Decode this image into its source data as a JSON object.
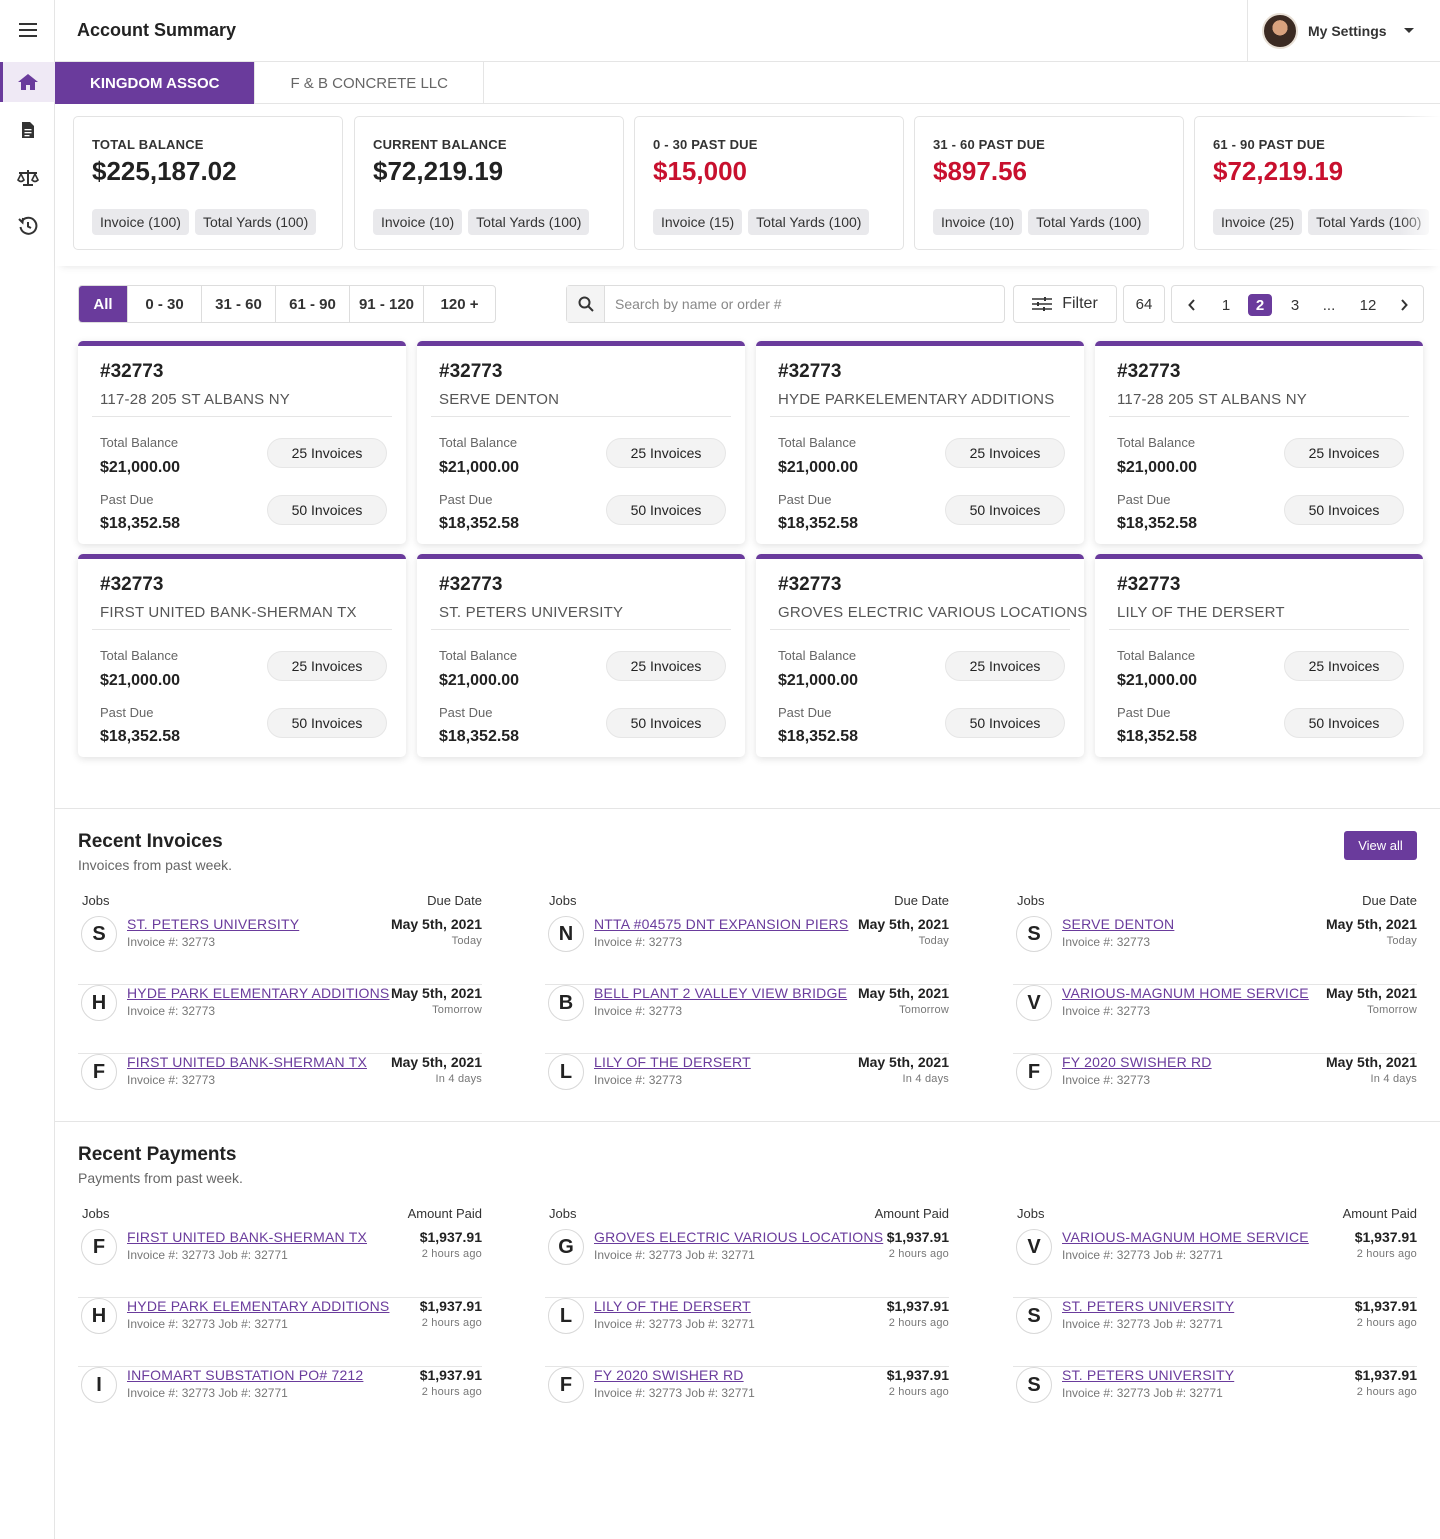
{
  "header": {
    "title": "Account Summary",
    "settings_label": "My Settings"
  },
  "sidebar": {
    "icons": [
      "menu-icon",
      "home-icon",
      "document-icon",
      "scale-icon",
      "history-icon"
    ]
  },
  "tabs": [
    {
      "label": "KINGDOM ASSOC",
      "active": true
    },
    {
      "label": "F & B CONCRETE LLC",
      "active": false
    }
  ],
  "summary": [
    {
      "label": "TOTAL BALANCE",
      "value": "$225,187.02",
      "red": false,
      "invoices": "Invoice (100)",
      "yards": "Total Yards (100)"
    },
    {
      "label": "CURRENT BALANCE",
      "value": "$72,219.19",
      "red": false,
      "invoices": "Invoice (10)",
      "yards": "Total Yards (100)"
    },
    {
      "label": "0 - 30 PAST DUE",
      "value": "$15,000",
      "red": true,
      "invoices": "Invoice (15)",
      "yards": "Total Yards (100)"
    },
    {
      "label": "31 - 60 PAST DUE",
      "value": "$897.56",
      "red": true,
      "invoices": "Invoice (10)",
      "yards": "Total Yards (100)"
    },
    {
      "label": "61 - 90 PAST DUE",
      "value": "$72,219.19",
      "red": true,
      "invoices": "Invoice (25)",
      "yards": "Total Yards (100)"
    }
  ],
  "filters": {
    "segments": [
      "All",
      "0 - 30",
      "31 - 60",
      "61 - 90",
      "91 - 120",
      "120 +"
    ],
    "active_segment": "All",
    "search_placeholder": "Search by name or order #",
    "filter_label": "Filter",
    "count": "64",
    "pages": [
      "1",
      "2",
      "3",
      "...",
      "12"
    ],
    "current_page": "2"
  },
  "jobs": [
    {
      "number": "#32773",
      "name": "117-28 205 ST ALBANS NY",
      "total_label": "Total Balance",
      "total": "$21,000.00",
      "total_invoices": "25 Invoices",
      "past_label": "Past Due",
      "past": "$18,352.58",
      "past_invoices": "50 Invoices"
    },
    {
      "number": "#32773",
      "name": "SERVE DENTON",
      "total_label": "Total Balance",
      "total": "$21,000.00",
      "total_invoices": "25 Invoices",
      "past_label": "Past Due",
      "past": "$18,352.58",
      "past_invoices": "50 Invoices"
    },
    {
      "number": "#32773",
      "name": "HYDE PARKELEMENTARY ADDITIONS",
      "total_label": "Total Balance",
      "total": "$21,000.00",
      "total_invoices": "25 Invoices",
      "past_label": "Past Due",
      "past": "$18,352.58",
      "past_invoices": "50 Invoices"
    },
    {
      "number": "#32773",
      "name": "117-28 205 ST ALBANS NY",
      "total_label": "Total Balance",
      "total": "$21,000.00",
      "total_invoices": "25 Invoices",
      "past_label": "Past Due",
      "past": "$18,352.58",
      "past_invoices": "50 Invoices"
    },
    {
      "number": "#32773",
      "name": "FIRST UNITED BANK-SHERMAN TX",
      "total_label": "Total Balance",
      "total": "$21,000.00",
      "total_invoices": "25 Invoices",
      "past_label": "Past Due",
      "past": "$18,352.58",
      "past_invoices": "50 Invoices"
    },
    {
      "number": "#32773",
      "name": "ST. PETERS UNIVERSITY",
      "total_label": "Total Balance",
      "total": "$21,000.00",
      "total_invoices": "25 Invoices",
      "past_label": "Past Due",
      "past": "$18,352.58",
      "past_invoices": "50 Invoices"
    },
    {
      "number": "#32773",
      "name": "GROVES ELECTRIC VARIOUS LOCATIONS",
      "total_label": "Total Balance",
      "total": "$21,000.00",
      "total_invoices": "25 Invoices",
      "past_label": "Past Due",
      "past": "$18,352.58",
      "past_invoices": "50 Invoices"
    },
    {
      "number": "#32773",
      "name": "LILY OF THE DERSERT",
      "total_label": "Total Balance",
      "total": "$21,000.00",
      "total_invoices": "25 Invoices",
      "past_label": "Past Due",
      "past": "$18,352.58",
      "past_invoices": "50 Invoices"
    }
  ],
  "recent_invoices": {
    "title": "Recent Invoices",
    "subtitle": "Invoices from past week.",
    "view_all": "View all",
    "col_left": "Jobs",
    "col_right": "Due Date",
    "columns": [
      [
        {
          "letter": "S",
          "name": "ST. PETERS UNIVERSITY",
          "sub": "Invoice #: 32773",
          "date": "May 5th, 2021",
          "rel": "Today"
        },
        {
          "letter": "H",
          "name": "HYDE PARK ELEMENTARY ADDITIONS",
          "sub": "Invoice #: 32773",
          "date": "May 5th, 2021",
          "rel": "Tomorrow"
        },
        {
          "letter": "F",
          "name": "FIRST UNITED BANK-SHERMAN TX",
          "sub": "Invoice #: 32773",
          "date": "May 5th, 2021",
          "rel": "In 4 days"
        }
      ],
      [
        {
          "letter": "N",
          "name": "NTTA #04575 DNT EXPANSION PIERS",
          "sub": "Invoice #: 32773",
          "date": "May 5th, 2021",
          "rel": "Today"
        },
        {
          "letter": "B",
          "name": "BELL PLANT 2 VALLEY VIEW BRIDGE",
          "sub": "Invoice #: 32773",
          "date": "May 5th, 2021",
          "rel": "Tomorrow"
        },
        {
          "letter": "L",
          "name": "LILY OF THE DERSERT",
          "sub": "Invoice #: 32773",
          "date": "May 5th, 2021",
          "rel": "In 4 days"
        }
      ],
      [
        {
          "letter": "S",
          "name": "SERVE DENTON",
          "sub": "Invoice #: 32773",
          "date": "May 5th, 2021",
          "rel": "Today"
        },
        {
          "letter": "V",
          "name": "VARIOUS-MAGNUM HOME SERVICE",
          "sub": "Invoice #: 32773",
          "date": "May 5th, 2021",
          "rel": "Tomorrow"
        },
        {
          "letter": "F",
          "name": "FY 2020 SWISHER RD",
          "sub": "Invoice #: 32773",
          "date": "May 5th, 2021",
          "rel": "In 4 days"
        }
      ]
    ]
  },
  "recent_payments": {
    "title": "Recent Payments",
    "subtitle": "Payments from past week.",
    "col_left": "Jobs",
    "col_right": "Amount Paid",
    "columns": [
      [
        {
          "letter": "F",
          "name": "FIRST UNITED BANK-SHERMAN TX",
          "sub": "Invoice #: 32773   Job #: 32771",
          "date": "$1,937.91",
          "rel": "2 hours ago"
        },
        {
          "letter": "H",
          "name": "HYDE PARK ELEMENTARY ADDITIONS",
          "sub": "Invoice #: 32773   Job #: 32771",
          "date": "$1,937.91",
          "rel": "2 hours ago"
        },
        {
          "letter": "I",
          "name": "INFOMART SUBSTATION PO# 7212",
          "sub": "Invoice #: 32773   Job #: 32771",
          "date": "$1,937.91",
          "rel": "2 hours ago"
        }
      ],
      [
        {
          "letter": "G",
          "name": "GROVES ELECTRIC VARIOUS LOCATIONS",
          "sub": "Invoice #: 32773   Job #: 32771",
          "date": "$1,937.91",
          "rel": "2 hours ago"
        },
        {
          "letter": "L",
          "name": "LILY OF THE DERSERT",
          "sub": "Invoice #: 32773   Job #: 32771",
          "date": "$1,937.91",
          "rel": "2 hours ago"
        },
        {
          "letter": "F",
          "name": "FY 2020 SWISHER RD",
          "sub": "Invoice #: 32773   Job #: 32771",
          "date": "$1,937.91",
          "rel": "2 hours ago"
        }
      ],
      [
        {
          "letter": "V",
          "name": "VARIOUS-MAGNUM HOME SERVICE",
          "sub": "Invoice #: 32773   Job #: 32771",
          "date": "$1,937.91",
          "rel": "2 hours ago"
        },
        {
          "letter": "S",
          "name": "ST. PETERS UNIVERSITY",
          "sub": "Invoice #: 32773   Job #: 32771",
          "date": "$1,937.91",
          "rel": "2 hours ago"
        },
        {
          "letter": "S",
          "name": "ST. PETERS UNIVERSITY",
          "sub": "Invoice #: 32773   Job #: 32771",
          "date": "$1,937.91",
          "rel": "2 hours ago"
        }
      ]
    ]
  },
  "colors": {
    "accent": "#6a3b9c",
    "danger": "#c8102e"
  }
}
